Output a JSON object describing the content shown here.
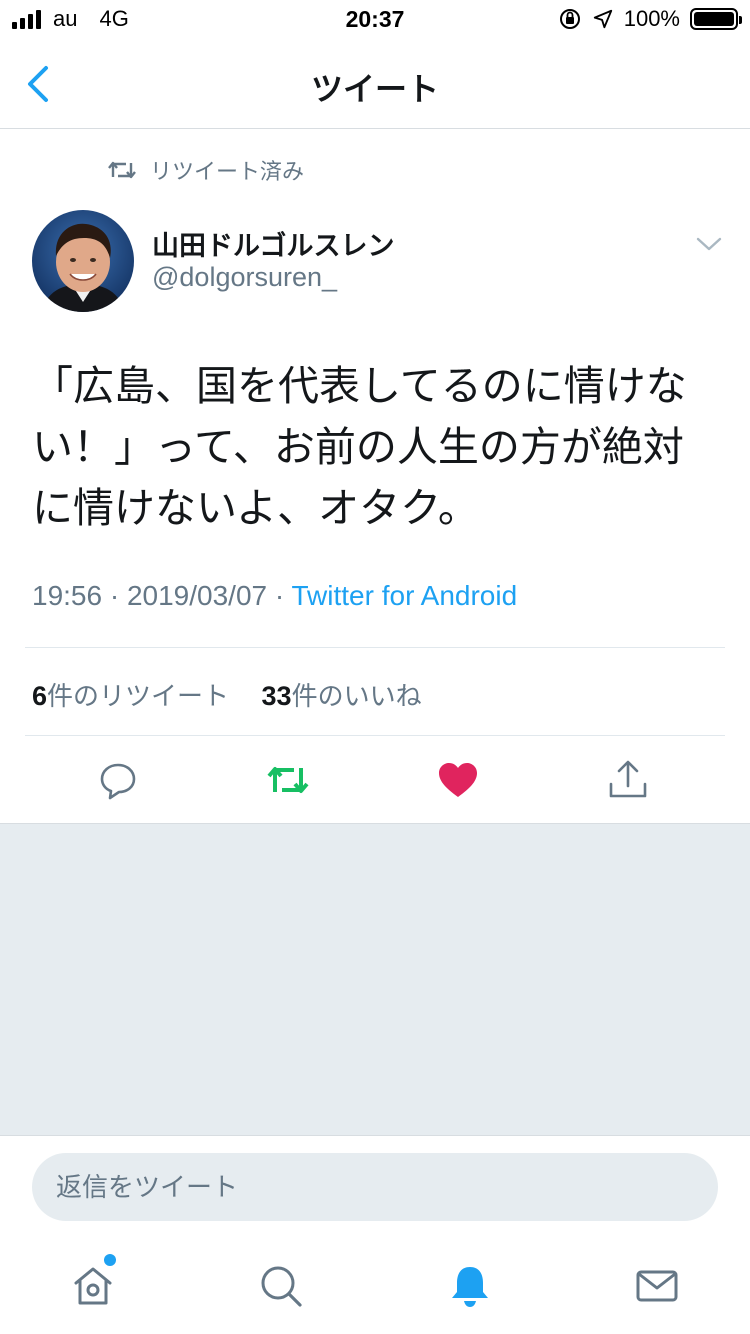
{
  "status_bar": {
    "carrier": "au",
    "network": "4G",
    "time": "20:37",
    "battery": "100%",
    "battery_level": 1.0
  },
  "nav": {
    "title": "ツイート",
    "back_icon": "chevron-left-icon"
  },
  "tweet": {
    "retweeted_label": "リツイート済み",
    "author_name": "山田ドルゴルスレン",
    "author_handle": "@dolgorsuren_",
    "text": "「広島、国を代表してるのに情けない！」って、お前の人生の方が絶対に情けないよ、オタク。",
    "time": "19:56",
    "date": "2019/03/07",
    "source": "Twitter for Android",
    "retweet_count": "6",
    "retweet_label": "件のリツイート",
    "like_count": "33",
    "like_label": "件のいいね",
    "liked": true,
    "retweeted": true
  },
  "reply": {
    "placeholder": "返信をツイート"
  },
  "tabs": [
    {
      "name": "home",
      "icon": "home-icon",
      "has_notification_dot": true
    },
    {
      "name": "search",
      "icon": "search-icon"
    },
    {
      "name": "notifications",
      "icon": "bell-icon",
      "active": true
    },
    {
      "name": "messages",
      "icon": "mail-icon"
    }
  ],
  "colors": {
    "accent": "#1da1f2",
    "retweet_green": "#17bf63",
    "like_red": "#e0245e",
    "secondary_text": "#657786",
    "background_grey": "#e6ecf0"
  }
}
